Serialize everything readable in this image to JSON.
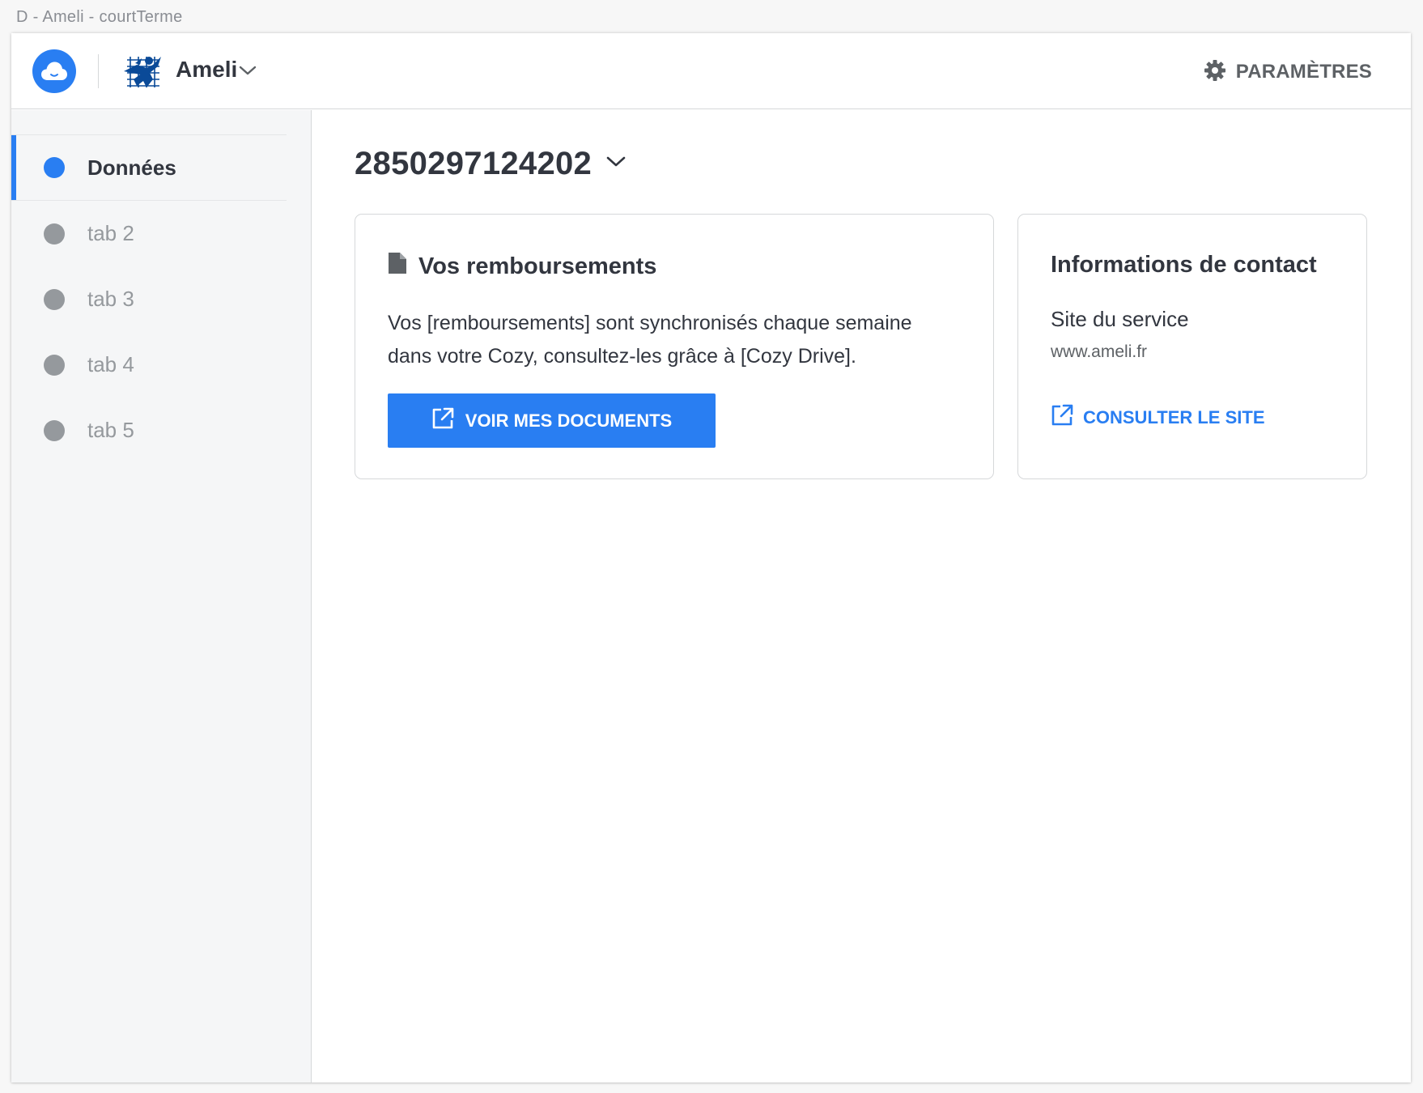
{
  "window": {
    "title": "D - Ameli - courtTerme"
  },
  "header": {
    "app_icon": "cozy-cloud-icon",
    "konnector_name": "Ameli",
    "konnector_icon": "ameli-logo",
    "settings_label": "PARAMÈTRES",
    "settings_icon": "gear-icon"
  },
  "sidebar": {
    "items": [
      {
        "label": "Données",
        "active": true
      },
      {
        "label": "tab 2",
        "active": false
      },
      {
        "label": "tab 3",
        "active": false
      },
      {
        "label": "tab 4",
        "active": false
      },
      {
        "label": "tab 5",
        "active": false
      }
    ]
  },
  "main": {
    "account_id": "2850297124202",
    "reimbursements_card": {
      "title": "Vos remboursements",
      "icon": "file-icon",
      "body_line1": "Vos [remboursements] sont synchronisés chaque semaine",
      "body_line2": "dans votre Cozy, consultez-les grâce à [Cozy Drive].",
      "button_label": "VOIR MES DOCUMENTS",
      "button_icon": "external-link-icon"
    },
    "contact_card": {
      "title": "Informations de contact",
      "site_label": "Site du service",
      "site_url": "www.ameli.fr",
      "link_label": "CONSULTER LE SITE",
      "link_icon": "external-link-icon"
    }
  },
  "colors": {
    "accent": "#297ef2",
    "text": "#32363f",
    "muted": "#95999d",
    "sidebar_bg": "#f5f6f7",
    "border": "#d6d8da"
  }
}
